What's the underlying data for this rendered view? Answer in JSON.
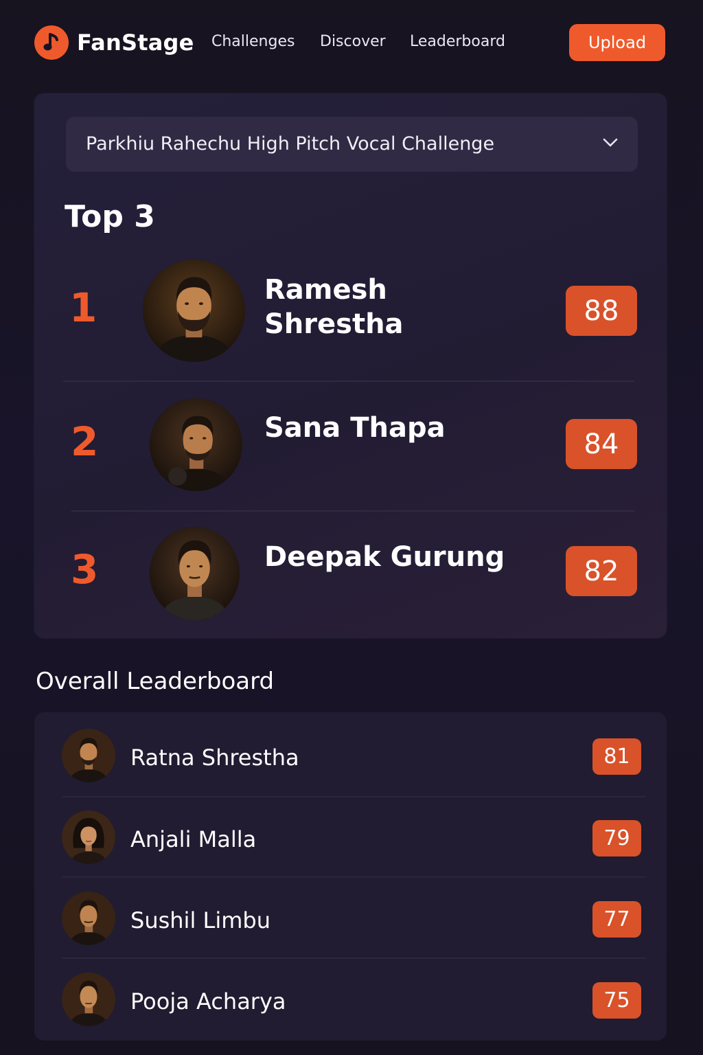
{
  "header": {
    "brand": "FanStage",
    "nav": [
      "Challenges",
      "Discover",
      "Leaderboard"
    ],
    "upload_label": "Upload"
  },
  "challenge": {
    "selected": "Parkhiu Rahechu High Pitch Vocal Challenge"
  },
  "top": {
    "title": "Top 3",
    "entries": [
      {
        "rank": "1",
        "name": "Ramesh Shrestha",
        "score": "88"
      },
      {
        "rank": "2",
        "name": "Sana Thapa",
        "score": "84"
      },
      {
        "rank": "3",
        "name": "Deepak Gurung",
        "score": "82"
      }
    ]
  },
  "overall": {
    "title": "Overall Leaderboard",
    "entries": [
      {
        "name": "Ratna Shrestha",
        "score": "81"
      },
      {
        "name": "Anjali Malla",
        "score": "79"
      },
      {
        "name": "Sushil Limbu",
        "score": "77"
      },
      {
        "name": "Pooja Acharya",
        "score": "75"
      }
    ]
  },
  "colors": {
    "accent": "#ef5a2c",
    "badge": "#d9522a",
    "background": "#16121f",
    "card": "#231d35"
  },
  "icons": {
    "logo": "music-note-icon",
    "dropdown": "chevron-down-icon"
  }
}
